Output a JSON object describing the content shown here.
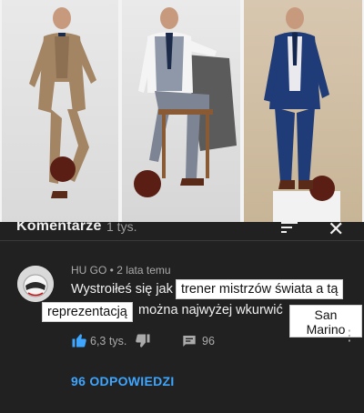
{
  "photos": [
    {
      "icon": "man-kicking-ball-photo"
    },
    {
      "icon": "man-seated-with-ball-photo"
    },
    {
      "icon": "man-standing-with-ball-photo"
    }
  ],
  "header": {
    "title": "Komentarze",
    "count": "1 tys.",
    "sort_icon": "sort-icon",
    "close_icon": "close-icon"
  },
  "comment": {
    "author": "HU GO",
    "time": "2 lata temu",
    "meta": "HU GO • 2 lata temu",
    "text_part1": "Wystroiłeś się jak",
    "highlight1": "trener mistrzów świata a tą",
    "highlight2": "reprezentacją",
    "text_part2": "można najwyżej wkurwić",
    "highlight3_line1": "San",
    "highlight3_line2": "Marino",
    "likes": "6,3 tys.",
    "replies_count": "96",
    "replies_link": "96 ODPOWIEDZI"
  },
  "colors": {
    "background": "#212121",
    "text": "#f1f1f1",
    "muted": "#aaaaaa",
    "link": "#3ea6ff",
    "like_accent": "#3ea6ff"
  }
}
